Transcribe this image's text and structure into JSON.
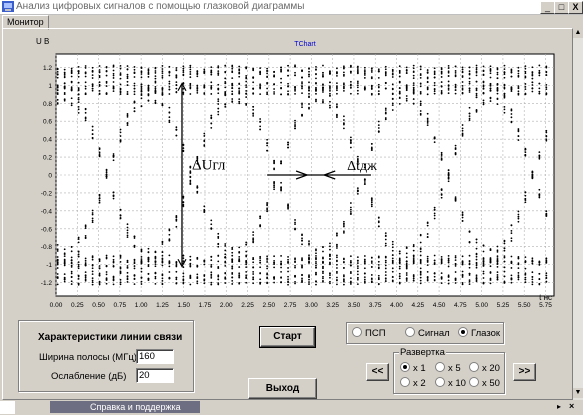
{
  "window": {
    "title": "Анализ цифровых сигналов с помощью глазковой диаграммы",
    "min_label": "_",
    "max_label": "□",
    "close_label": "X"
  },
  "tabs": [
    {
      "label": "Монитор",
      "active": true
    }
  ],
  "chart": {
    "header": "TChart",
    "ylabel": "U  B",
    "xlabel": "t  нс",
    "annotations": {
      "delta_u": "ΔUгл",
      "delta_t": "Δtдж"
    }
  },
  "chart_data": {
    "type": "scatter",
    "title": "TChart",
    "xlabel": "t  нс",
    "ylabel": "U  B",
    "xlim": [
      0,
      5.85
    ],
    "ylim": [
      -1.35,
      1.35
    ],
    "x_ticks": [
      "0.00",
      "0.25",
      "0.50",
      "0.75",
      "1.00",
      "1.25",
      "1.50",
      "1.75",
      "2.00",
      "2.25",
      "2.50",
      "2.75",
      "3.00",
      "3.25",
      "3.50",
      "3.75",
      "4.00",
      "4.25",
      "4.50",
      "4.75",
      "5.00",
      "5.25",
      "5.50",
      "5.75"
    ],
    "y_ticks": [
      "1.2",
      "1",
      "0.8",
      "0.6",
      "0.4",
      "0.2",
      "0",
      "-0.2",
      "-0.4",
      "-0.6",
      "-0.8",
      "-1",
      "-1.2"
    ],
    "grid": true,
    "series": [
      {
        "description": "eye diagram traces",
        "color": "#000000"
      }
    ]
  },
  "link_params": {
    "title": "Характеристики линии связи",
    "bandwidth_label": "Ширина полосы (МГц)",
    "bandwidth_value": "160",
    "attenuation_label": "Ослабление (дБ)",
    "attenuation_value": "20"
  },
  "buttons": {
    "start": "Старт",
    "exit": "Выход",
    "prev": "<<",
    "next": ">>"
  },
  "mode": {
    "options": [
      {
        "label": "ПСП",
        "checked": false
      },
      {
        "label": "Сигнал",
        "checked": false
      },
      {
        "label": "Глазок",
        "checked": true
      }
    ]
  },
  "sweep": {
    "title": "Развертка",
    "options": [
      {
        "label": "x 1",
        "checked": true
      },
      {
        "label": "x 5",
        "checked": false
      },
      {
        "label": "x 20",
        "checked": false
      },
      {
        "label": "x 2",
        "checked": false
      },
      {
        "label": "x 10",
        "checked": false
      },
      {
        "label": "x 50",
        "checked": false
      }
    ]
  },
  "taskbar": {
    "item": "Справка и поддержка"
  }
}
